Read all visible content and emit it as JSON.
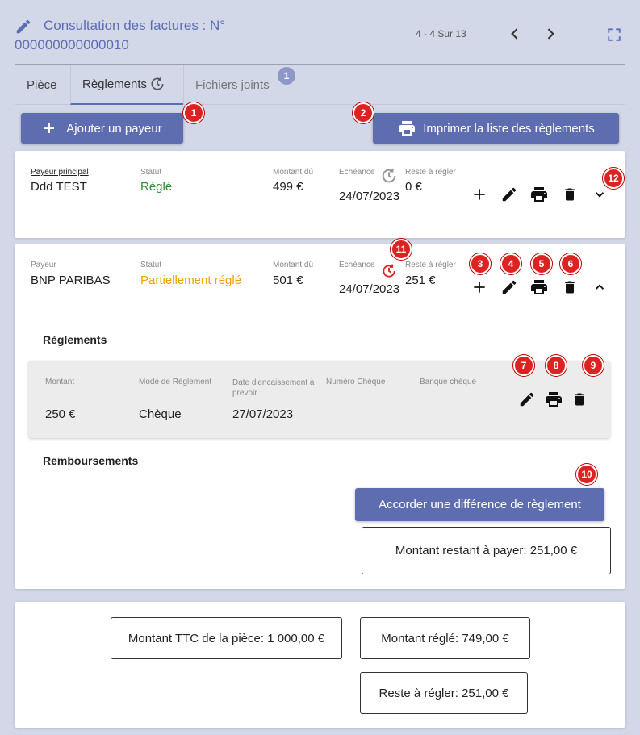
{
  "header": {
    "title": "Consultation des factures : N° 000000000000010",
    "pager": "4 - 4 Sur 13"
  },
  "tabs": [
    {
      "label": "Pièce"
    },
    {
      "label": "Règlements"
    },
    {
      "label": "Fichiers joints",
      "badge": "1"
    }
  ],
  "actions": {
    "add_payer": "Ajouter un payeur",
    "print_list": "Imprimer la liste des règlements"
  },
  "payer1": {
    "payer_label": "Payeur principal",
    "payer_name": "Ddd TEST",
    "status_label": "Statut",
    "status": "Réglé",
    "due_label": "Montant dû",
    "due": "499 €",
    "date_label": "Echéance",
    "date": "24/07/2023",
    "rest_label": "Reste à régler",
    "rest": "0 €"
  },
  "payer2": {
    "payer_label": "Payeur",
    "payer_name": "BNP PARIBAS",
    "status_label": "Statut",
    "status": "Partiellement réglé",
    "due_label": "Montant dû",
    "due": "501 €",
    "date_label": "Echéance",
    "date": "24/07/2023",
    "rest_label": "Reste à régler",
    "rest": "251 €",
    "reglements_title": "Règlements",
    "reglement": {
      "amount_label": "Montant",
      "amount": "250 €",
      "mode_label": "Mode de Règlement",
      "mode": "Chèque",
      "date_label": "Date d'encaissement à prevoir",
      "date": "27/07/2023",
      "cheque_label": "Numéro Chèque",
      "bank_label": "Banque chèque"
    },
    "remb_title": "Remboursements",
    "diff_button": "Accorder une différence de règlement",
    "remaining_label": "Montant restant à payer:",
    "remaining_value": "251,00 €"
  },
  "totals": {
    "ttc_label": "Montant TTC de la pièce:",
    "ttc_value": "1 000,00 €",
    "paid_label": "Montant réglé:",
    "paid_value": "749,00 €",
    "rest_label": "Reste à régler:",
    "rest_value": "251,00 €"
  },
  "markers": [
    "1",
    "2",
    "3",
    "4",
    "5",
    "6",
    "7",
    "8",
    "9",
    "10",
    "11",
    "12"
  ],
  "colors": {
    "accent": "#5e6db0",
    "marker": "#dd2222",
    "ok": "#2e8b2e",
    "partial": "#f0a000"
  }
}
